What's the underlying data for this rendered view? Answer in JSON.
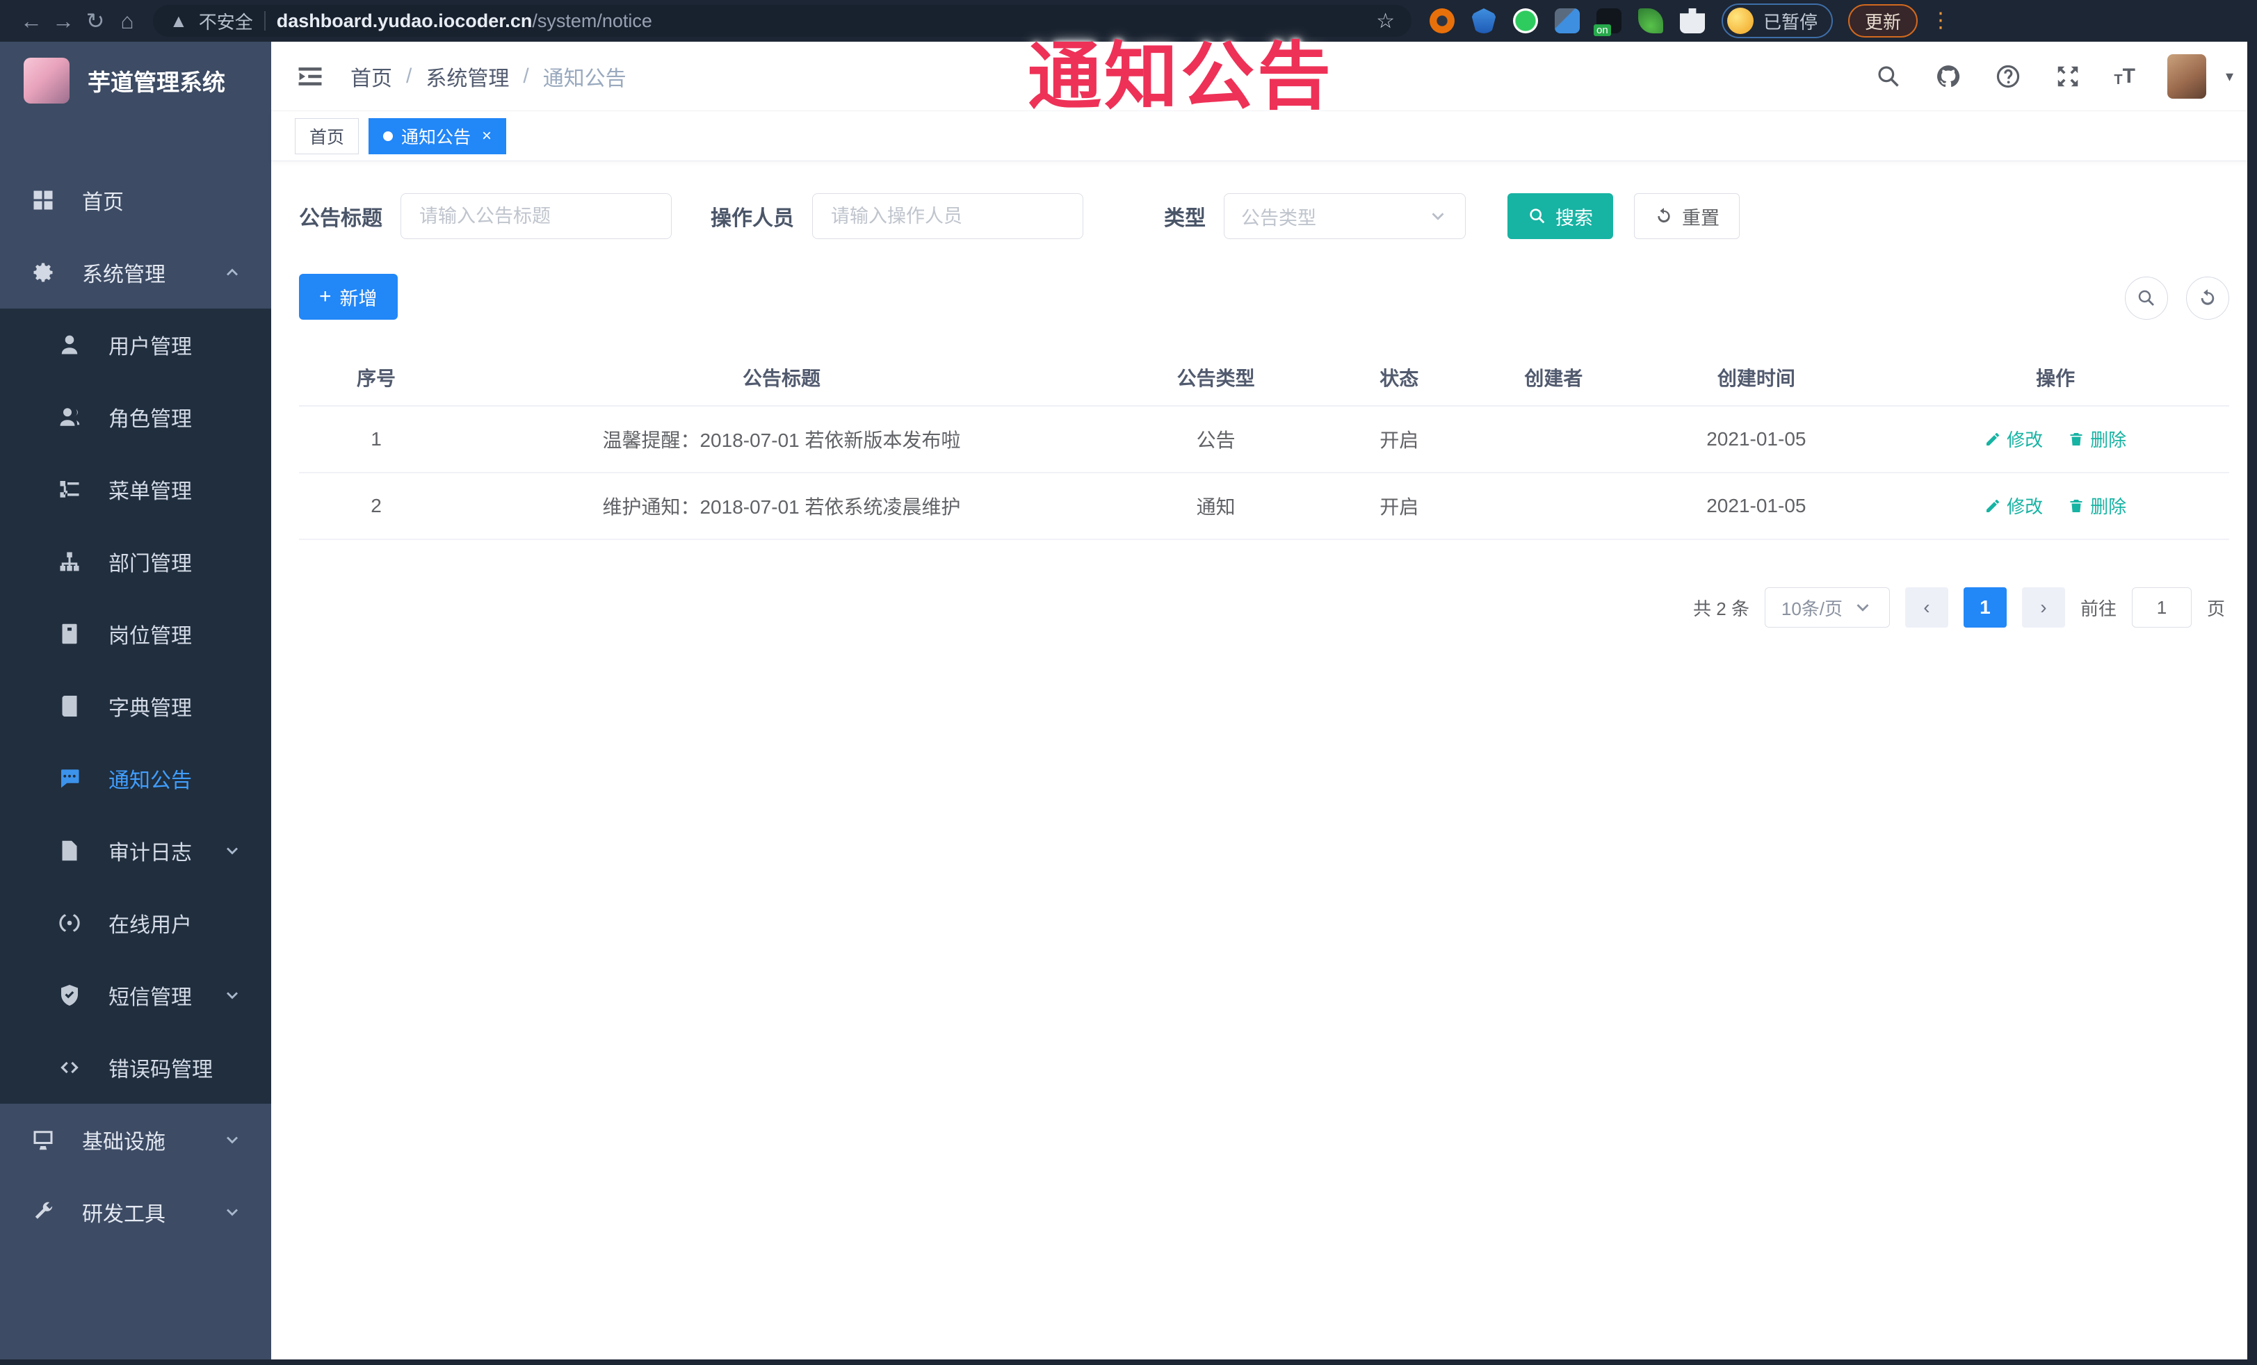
{
  "browser": {
    "security_label": "不安全",
    "url_host": "dashboard.yudao.iocoder.cn",
    "url_path": "/system/notice",
    "paused_label": "已暂停",
    "update_label": "更新"
  },
  "overlay": {
    "title": "通知公告",
    "color": "#ee3157"
  },
  "sidebar": {
    "app_title": "芋道管理系统",
    "menu": [
      {
        "key": "home",
        "label": "首页",
        "icon": "home-icon",
        "level": "top"
      },
      {
        "key": "system",
        "label": "系统管理",
        "icon": "gear-icon",
        "level": "top",
        "arrow": "up"
      },
      {
        "key": "user-mgmt",
        "label": "用户管理",
        "icon": "user-icon",
        "level": "sub"
      },
      {
        "key": "role-mgmt",
        "label": "角色管理",
        "icon": "users-icon",
        "level": "sub"
      },
      {
        "key": "menu-mgmt",
        "label": "菜单管理",
        "icon": "menu-tree-icon",
        "level": "sub"
      },
      {
        "key": "dept-mgmt",
        "label": "部门管理",
        "icon": "org-icon",
        "level": "sub"
      },
      {
        "key": "post-mgmt",
        "label": "岗位管理",
        "icon": "badge-icon",
        "level": "sub"
      },
      {
        "key": "dict-mgmt",
        "label": "字典管理",
        "icon": "book-icon",
        "level": "sub"
      },
      {
        "key": "notice",
        "label": "通知公告",
        "icon": "message-icon",
        "level": "sub",
        "active": true
      },
      {
        "key": "audit-log",
        "label": "审计日志",
        "icon": "log-icon",
        "level": "sub",
        "arrow": "down"
      },
      {
        "key": "online-user",
        "label": "在线用户",
        "icon": "online-icon",
        "level": "sub"
      },
      {
        "key": "sms-mgmt",
        "label": "短信管理",
        "icon": "shield-icon",
        "level": "sub",
        "arrow": "down"
      },
      {
        "key": "errcode-mgmt",
        "label": "错误码管理",
        "icon": "code-icon",
        "level": "sub"
      },
      {
        "key": "infra",
        "label": "基础设施",
        "icon": "monitor-icon",
        "level": "top",
        "arrow": "down"
      },
      {
        "key": "dev-tools",
        "label": "研发工具",
        "icon": "tools-icon",
        "level": "top",
        "arrow": "down"
      }
    ]
  },
  "header": {
    "breadcrumb": [
      "首页",
      "系统管理",
      "通知公告"
    ]
  },
  "tags": [
    {
      "label": "首页",
      "active": false
    },
    {
      "label": "通知公告",
      "active": true,
      "closable": true
    }
  ],
  "filters": {
    "title_label": "公告标题",
    "title_placeholder": "请输入公告标题",
    "operator_label": "操作人员",
    "operator_placeholder": "请输入操作人员",
    "type_label": "类型",
    "type_placeholder": "公告类型",
    "search_label": "搜索",
    "reset_label": "重置"
  },
  "toolbar": {
    "add_label": "新增"
  },
  "table": {
    "headers": [
      "序号",
      "公告标题",
      "公告类型",
      "状态",
      "创建者",
      "创建时间",
      "操作"
    ],
    "col_widths": [
      "8%",
      "34%",
      "11%",
      "8%",
      "8%",
      "13%",
      "18%"
    ],
    "edit_label": "修改",
    "delete_label": "删除",
    "rows": [
      {
        "no": "1",
        "title": "温馨提醒：2018-07-01 若依新版本发布啦",
        "type": "公告",
        "status": "开启",
        "creator": "",
        "created": "2021-01-05"
      },
      {
        "no": "2",
        "title": "维护通知：2018-07-01 若依系统凌晨维护",
        "type": "通知",
        "status": "开启",
        "creator": "",
        "created": "2021-01-05"
      }
    ]
  },
  "pagination": {
    "total_label": "共 2 条",
    "page_size": "10条/页",
    "current_page": "1",
    "goto_label": "前往",
    "goto_value": "1",
    "page_unit": "页"
  },
  "colors": {
    "primary_blue": "#2287f7",
    "teal_accent": "#17b3a3",
    "sidebar_bg": "#3d4b64",
    "submenu_bg": "#202e3e",
    "active_menu_link": "#409eff",
    "overlay_red": "#ee3157",
    "browser_bar_bg": "#1d2634"
  }
}
